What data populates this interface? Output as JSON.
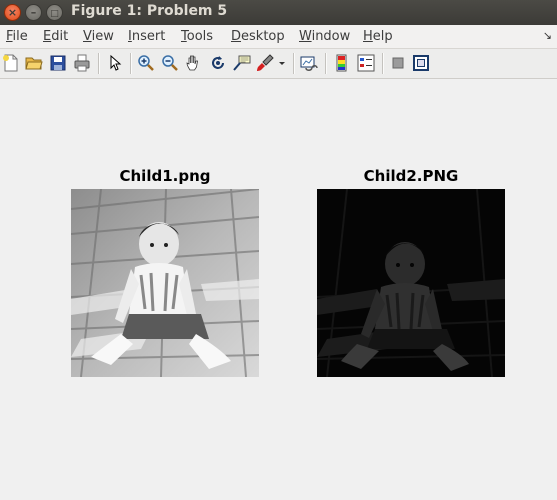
{
  "window": {
    "title": "Figure 1: Problem 5",
    "close_glyph": "×",
    "minimize_glyph": "–",
    "maximize_glyph": "□"
  },
  "menu": {
    "items": [
      {
        "label": "File",
        "mnemonic": "F",
        "rest": "ile"
      },
      {
        "label": "Edit",
        "mnemonic": "E",
        "rest": "dit"
      },
      {
        "label": "View",
        "mnemonic": "V",
        "rest": "iew"
      },
      {
        "label": "Insert",
        "mnemonic": "I",
        "rest": "nsert"
      },
      {
        "label": "Tools",
        "mnemonic": "T",
        "rest": "ools"
      },
      {
        "label": "Desktop",
        "mnemonic": "D",
        "rest": "esktop"
      },
      {
        "label": "Window",
        "mnemonic": "W",
        "rest": "indow"
      },
      {
        "label": "Help",
        "mnemonic": "H",
        "rest": "elp"
      }
    ],
    "dock_glyph": "↘"
  },
  "toolbar": {
    "icons": [
      "new-figure-icon",
      "open-file-icon",
      "save-figure-icon",
      "print-figure-icon",
      "edit-plot-icon",
      "zoom-in-icon",
      "zoom-out-icon",
      "pan-icon",
      "rotate-3d-icon",
      "data-cursor-icon",
      "brush-icon",
      "brush-dropdown-icon",
      "link-plot-icon",
      "insert-colorbar-icon",
      "insert-legend-icon",
      "hide-plot-tools-icon",
      "show-plot-tools-icon"
    ]
  },
  "axes": [
    {
      "title": "Child1.png",
      "image": "bright grayscale photo of child sitting on wooden floor"
    },
    {
      "title": "Child2.PNG",
      "image": "dark grayscale photo of child sitting on wooden floor"
    }
  ]
}
